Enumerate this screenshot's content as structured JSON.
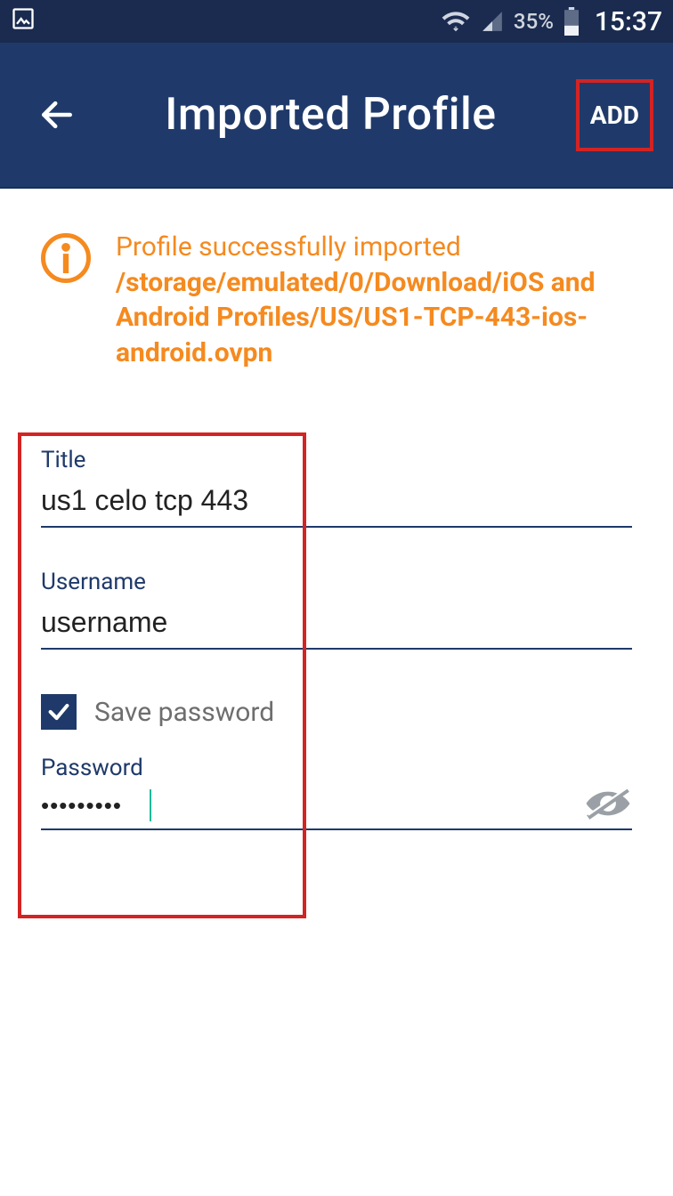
{
  "statusbar": {
    "battery_pct": "35%",
    "time": "15:37"
  },
  "header": {
    "title": "Imported Profile",
    "add_label": "ADD"
  },
  "banner": {
    "line1": "Profile successfully imported",
    "path": "/storage/emulated/0/Download/iOS and Android Profiles/US/US1-TCP-443-ios-android.ovpn"
  },
  "form": {
    "title_label": "Title",
    "title_value": "us1 celo tcp 443",
    "username_label": "Username",
    "username_value": "username",
    "save_password_label": "Save password",
    "password_label": "Password",
    "password_value": "•••••••••"
  }
}
